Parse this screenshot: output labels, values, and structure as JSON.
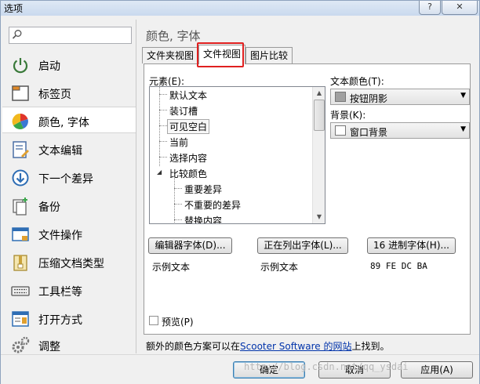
{
  "window": {
    "title": "选项",
    "help_label": "?",
    "close_label": "✕"
  },
  "sidebar": {
    "search_placeholder": "",
    "items": [
      {
        "label": "启动",
        "icon": "power-icon"
      },
      {
        "label": "标签页",
        "icon": "tab-page-icon"
      },
      {
        "label": "颜色, 字体",
        "icon": "color-palette-icon",
        "selected": true
      },
      {
        "label": "文本编辑",
        "icon": "text-edit-icon"
      },
      {
        "label": "下一个差异",
        "icon": "next-diff-icon"
      },
      {
        "label": "备份",
        "icon": "backup-icon"
      },
      {
        "label": "文件操作",
        "icon": "file-operation-icon"
      },
      {
        "label": "压缩文档类型",
        "icon": "archive-icon"
      },
      {
        "label": "工具栏等",
        "icon": "keyboard-toolbar-icon"
      },
      {
        "label": "打开方式",
        "icon": "open-with-icon"
      },
      {
        "label": "调整",
        "icon": "gears-icon"
      }
    ]
  },
  "main": {
    "title": "颜色, 字体",
    "tabs": [
      {
        "label": "文件夹视图"
      },
      {
        "label": "文件视图",
        "active": true
      },
      {
        "label": "图片比较"
      }
    ],
    "elements_label": "元素(E):",
    "tree": [
      {
        "label": "默认文本"
      },
      {
        "label": "装订槽"
      },
      {
        "label": "可见空白",
        "selected": true
      },
      {
        "label": "当前"
      },
      {
        "label": "选择内容"
      },
      {
        "label": "比较颜色",
        "expanded": true
      },
      {
        "label": "重要差异",
        "child": true
      },
      {
        "label": "不重要的差异",
        "child": true
      },
      {
        "label": "替换内容",
        "child": true
      }
    ],
    "text_color_label": "文本颜色(T):",
    "text_color_value": "按钮阴影",
    "text_color_swatch": "#a0a0a0",
    "background_label": "背景(K):",
    "background_value": "窗口背景",
    "background_swatch": "#ffffff",
    "font_buttons": [
      "编辑器字体(D)...",
      "正在列出字体(L)...",
      "16 进制字体(H)..."
    ],
    "samples": [
      "示例文本",
      "示例文本",
      "89 FE DC BA"
    ],
    "preview_label": "预览(P)",
    "preview_checked": false,
    "footer_prefix": "额外的颜色方案可以在",
    "footer_link": "Scooter Software 的网站",
    "footer_suffix": "上找到。"
  },
  "buttons": {
    "ok": "确定",
    "cancel": "取消",
    "apply": "应用(A)"
  },
  "watermark": "http://blog.csdn.net/qq_ysdai"
}
